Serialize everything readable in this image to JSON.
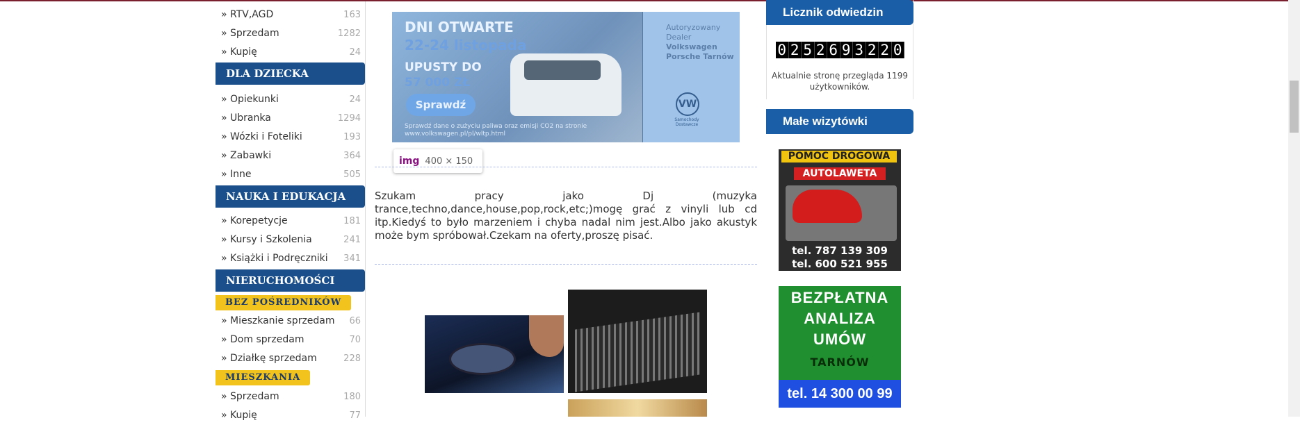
{
  "sidebar": {
    "top_items": [
      {
        "label": "» RTV,AGD",
        "count": "163"
      },
      {
        "label": "» Sprzedam",
        "count": "1282"
      },
      {
        "label": "» Kupię",
        "count": "24"
      }
    ],
    "sections": [
      {
        "title": "DLA DZIECKA",
        "items": [
          {
            "label": "» Opiekunki",
            "count": "24"
          },
          {
            "label": "» Ubranka",
            "count": "1294"
          },
          {
            "label": "» Wózki i Foteliki",
            "count": "193"
          },
          {
            "label": "» Zabawki",
            "count": "364"
          },
          {
            "label": "» Inne",
            "count": "505"
          }
        ]
      },
      {
        "title": "NAUKA I EDUKACJA",
        "items": [
          {
            "label": "» Korepetycje",
            "count": "181"
          },
          {
            "label": "» Kursy i Szkolenia",
            "count": "241"
          },
          {
            "label": "» Książki i Podręczniki",
            "count": "341"
          }
        ]
      },
      {
        "title": "NIERUCHOMOŚCI",
        "sub1": "BEZ POŚREDNIKÓW",
        "items": [
          {
            "label": "» Mieszkanie sprzedam",
            "count": "66"
          },
          {
            "label": "» Dom sprzedam",
            "count": "70"
          },
          {
            "label": "» Działkę sprzedam",
            "count": "228"
          }
        ],
        "sub2": "MIESZKANIA",
        "items2": [
          {
            "label": "» Sprzedam",
            "count": "180"
          },
          {
            "label": "» Kupię",
            "count": "77"
          }
        ]
      }
    ]
  },
  "ad_vw": {
    "line1": "DNI OTWARTE",
    "line2": "22-24 listopada",
    "line3": "UPUSTY DO",
    "line4": "57 000 ZŁ",
    "button": "Sprawdź",
    "fine": "Sprawdź dane o zużyciu paliwa oraz emisji CO2 na stronie www.volkswagen.pl/pl/wltp.html",
    "dealer1": "Autoryzowany",
    "dealer2": "Dealer",
    "dealer3": "Volkswagen",
    "dealer4": "Porsche Tarnów",
    "logo": "VW",
    "logo_caption": "Samochody Dostawcze"
  },
  "tooltip": {
    "tag": "img",
    "dims": "400 × 150"
  },
  "description": "Szukam pracy jako Dj (muzyka trance,techno,dance,house,pop,rock,etc;)mogę grać z vinyli lub cd itp.Kiedyś to było marzeniem i chyba nadal nim jest.Albo jako akustyk może bym spróbował.Czekam na oferty,proszę pisać.",
  "right": {
    "counter_title": "Licznik odwiedzin",
    "counter_digits": [
      "0",
      "2",
      "5",
      "2",
      "6",
      "9",
      "3",
      "2",
      "2",
      "0"
    ],
    "counter_text": "Aktualnie stronę przegląda 1199 użytkowników.",
    "cards_title": "Małe wizytówki",
    "ad_road": {
      "line1": "POMOC DROGOWA",
      "line2": "AUTOLAWETA",
      "tel1": "tel. 787 139 309",
      "tel2": "tel. 600 521 955"
    },
    "ad_green": {
      "line1": "BEZPŁATNA",
      "line2": "ANALIZA",
      "line3": "UMÓW",
      "city": "TARNÓW",
      "tel": "tel. 14 300 00 99"
    }
  },
  "colors": {
    "section_header": "#1a4f8c",
    "badge": "#f2c31c",
    "widget_header": "#1a5ea8"
  }
}
